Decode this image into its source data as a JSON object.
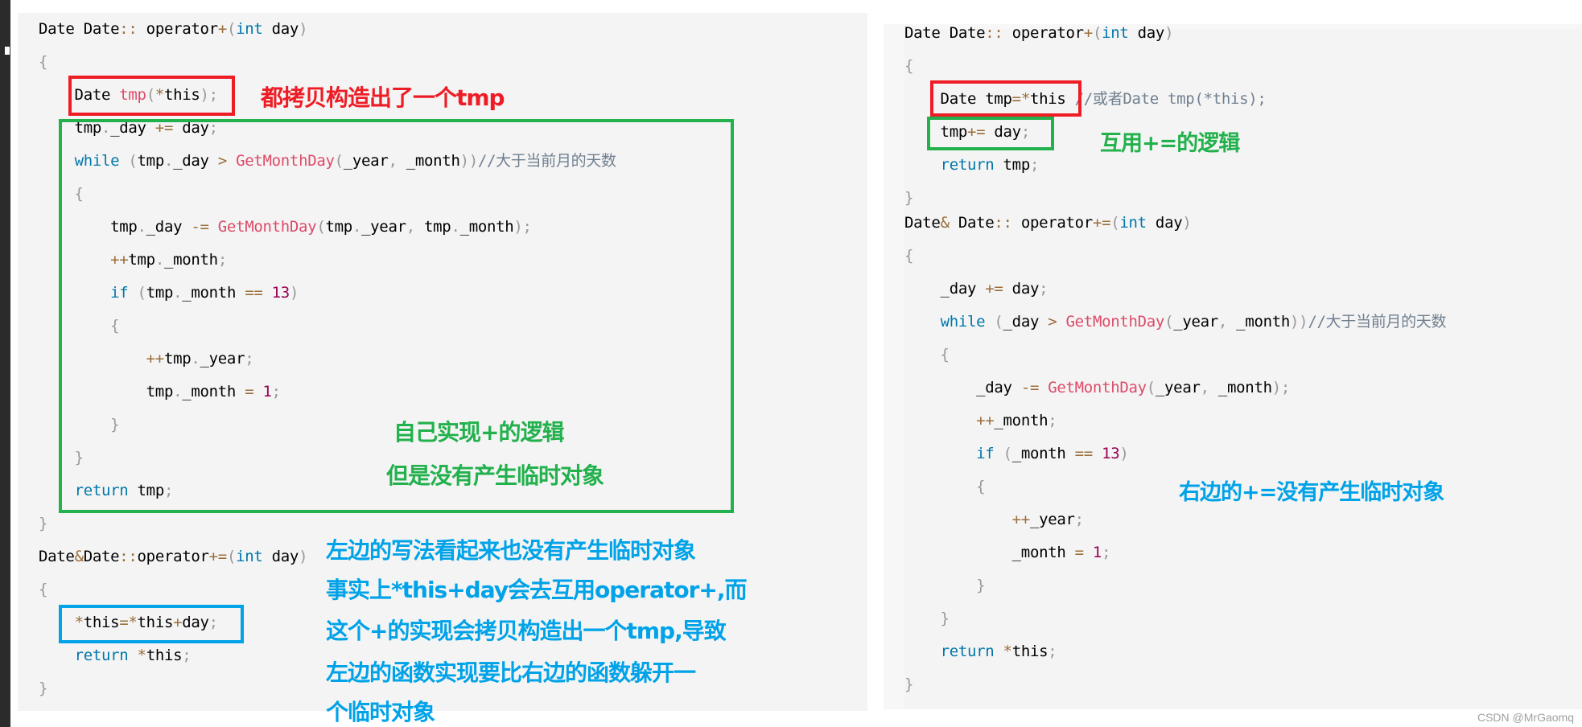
{
  "colors": {
    "red": "#ee1c25",
    "green": "#22b14c",
    "blue": "#00a2e8",
    "panel_bg": "#f4f4f4"
  },
  "left_code": [
    [
      [
        "Date Date",
        "t-plain"
      ],
      [
        "::",
        "t-op"
      ],
      [
        " operator",
        "t-plain"
      ],
      [
        "+",
        "t-op"
      ],
      [
        "(",
        "t-punc"
      ],
      [
        "int",
        "t-kw"
      ],
      [
        " day",
        "t-plain"
      ],
      [
        ")",
        "t-punc"
      ]
    ],
    [
      [
        "{",
        "t-punc"
      ]
    ],
    [
      [
        "    Date ",
        "t-plain"
      ],
      [
        "tmp",
        "t-fn"
      ],
      [
        "(",
        "t-punc"
      ],
      [
        "*",
        "t-op"
      ],
      [
        "this",
        "t-plain"
      ],
      [
        ")",
        "t-punc"
      ],
      [
        ";",
        "t-punc"
      ]
    ],
    [
      [
        "    tmp",
        "t-plain"
      ],
      [
        ".",
        "t-punc"
      ],
      [
        "_day ",
        "t-plain"
      ],
      [
        "+=",
        "t-op"
      ],
      [
        " day",
        "t-plain"
      ],
      [
        ";",
        "t-punc"
      ]
    ],
    [
      [
        "    ",
        "t-plain"
      ],
      [
        "while",
        "t-kw"
      ],
      [
        " ",
        "t-plain"
      ],
      [
        "(",
        "t-punc"
      ],
      [
        "tmp",
        "t-plain"
      ],
      [
        ".",
        "t-punc"
      ],
      [
        "_day ",
        "t-plain"
      ],
      [
        ">",
        "t-op"
      ],
      [
        " ",
        "t-plain"
      ],
      [
        "GetMonthDay",
        "t-fn"
      ],
      [
        "(",
        "t-punc"
      ],
      [
        "_year",
        "t-plain"
      ],
      [
        ",",
        "t-punc"
      ],
      [
        " _month",
        "t-plain"
      ],
      [
        "))",
        "t-punc"
      ],
      [
        "//大于当前月的天数",
        "t-comment"
      ]
    ],
    [
      [
        "    {",
        "t-punc"
      ]
    ],
    [
      [
        "        tmp",
        "t-plain"
      ],
      [
        ".",
        "t-punc"
      ],
      [
        "_day ",
        "t-plain"
      ],
      [
        "-=",
        "t-op"
      ],
      [
        " ",
        "t-plain"
      ],
      [
        "GetMonthDay",
        "t-fn"
      ],
      [
        "(",
        "t-punc"
      ],
      [
        "tmp",
        "t-plain"
      ],
      [
        ".",
        "t-punc"
      ],
      [
        "_year",
        "t-plain"
      ],
      [
        ",",
        "t-punc"
      ],
      [
        " tmp",
        "t-plain"
      ],
      [
        ".",
        "t-punc"
      ],
      [
        "_month",
        "t-plain"
      ],
      [
        ");",
        "t-punc"
      ]
    ],
    [
      [
        "        ",
        "t-plain"
      ],
      [
        "++",
        "t-op"
      ],
      [
        "tmp",
        "t-plain"
      ],
      [
        ".",
        "t-punc"
      ],
      [
        "_month",
        "t-plain"
      ],
      [
        ";",
        "t-punc"
      ]
    ],
    [
      [
        "        ",
        "t-plain"
      ],
      [
        "if",
        "t-kw"
      ],
      [
        " ",
        "t-plain"
      ],
      [
        "(",
        "t-punc"
      ],
      [
        "tmp",
        "t-plain"
      ],
      [
        ".",
        "t-punc"
      ],
      [
        "_month ",
        "t-plain"
      ],
      [
        "==",
        "t-op"
      ],
      [
        " ",
        "t-plain"
      ],
      [
        "13",
        "t-num"
      ],
      [
        ")",
        "t-punc"
      ]
    ],
    [
      [
        "        {",
        "t-punc"
      ]
    ],
    [
      [
        "            ",
        "t-plain"
      ],
      [
        "++",
        "t-op"
      ],
      [
        "tmp",
        "t-plain"
      ],
      [
        ".",
        "t-punc"
      ],
      [
        "_year",
        "t-plain"
      ],
      [
        ";",
        "t-punc"
      ]
    ],
    [
      [
        "            tmp",
        "t-plain"
      ],
      [
        ".",
        "t-punc"
      ],
      [
        "_month ",
        "t-plain"
      ],
      [
        "=",
        "t-op"
      ],
      [
        " ",
        "t-plain"
      ],
      [
        "1",
        "t-num"
      ],
      [
        ";",
        "t-punc"
      ]
    ],
    [
      [
        "        }",
        "t-punc"
      ]
    ],
    [
      [
        "    }",
        "t-punc"
      ]
    ],
    [
      [
        "    ",
        "t-plain"
      ],
      [
        "return",
        "t-kw"
      ],
      [
        " tmp",
        "t-plain"
      ],
      [
        ";",
        "t-punc"
      ]
    ],
    [
      [
        "}",
        "t-punc"
      ]
    ],
    [
      [
        "Date",
        "t-plain"
      ],
      [
        "&",
        "t-op"
      ],
      [
        "Date",
        "t-plain"
      ],
      [
        "::",
        "t-op"
      ],
      [
        "operator",
        "t-plain"
      ],
      [
        "+=",
        "t-op"
      ],
      [
        "(",
        "t-punc"
      ],
      [
        "int",
        "t-kw"
      ],
      [
        " day",
        "t-plain"
      ],
      [
        ")",
        "t-punc"
      ]
    ],
    [
      [
        "{",
        "t-punc"
      ]
    ],
    [
      [
        "    ",
        "t-plain"
      ],
      [
        "*",
        "t-op"
      ],
      [
        "this",
        "t-plain"
      ],
      [
        "=",
        "t-op"
      ],
      [
        "*",
        "t-op"
      ],
      [
        "this",
        "t-plain"
      ],
      [
        "+",
        "t-op"
      ],
      [
        "day",
        "t-plain"
      ],
      [
        ";",
        "t-punc"
      ]
    ],
    [
      [
        "    ",
        "t-plain"
      ],
      [
        "return",
        "t-kw"
      ],
      [
        " ",
        "t-plain"
      ],
      [
        "*",
        "t-op"
      ],
      [
        "this",
        "t-plain"
      ],
      [
        ";",
        "t-punc"
      ]
    ],
    [
      [
        "}",
        "t-punc"
      ]
    ]
  ],
  "right_code": [
    [
      [
        "Date Date",
        "t-plain"
      ],
      [
        "::",
        "t-op"
      ],
      [
        " operator",
        "t-plain"
      ],
      [
        "+",
        "t-op"
      ],
      [
        "(",
        "t-punc"
      ],
      [
        "int",
        "t-kw"
      ],
      [
        " day",
        "t-plain"
      ],
      [
        ")",
        "t-punc"
      ]
    ],
    [
      [
        "{",
        "t-punc"
      ]
    ],
    [
      [
        "    Date tmp",
        "t-plain"
      ],
      [
        "=",
        "t-op"
      ],
      [
        "*",
        "t-op"
      ],
      [
        "this",
        "t-plain"
      ],
      [
        " //或者Date tmp(*this);",
        "t-comment"
      ]
    ],
    [
      [
        "    tmp",
        "t-plain"
      ],
      [
        "+=",
        "t-op"
      ],
      [
        " day",
        "t-plain"
      ],
      [
        ";",
        "t-punc"
      ]
    ],
    [
      [
        "    ",
        "t-plain"
      ],
      [
        "return",
        "t-kw"
      ],
      [
        " tmp",
        "t-plain"
      ],
      [
        ";",
        "t-punc"
      ]
    ],
    [
      [
        "}",
        "t-punc"
      ]
    ],
    [
      [
        "Date",
        "t-plain"
      ],
      [
        "&",
        "t-op"
      ],
      [
        " Date",
        "t-plain"
      ],
      [
        "::",
        "t-op"
      ],
      [
        " operator",
        "t-plain"
      ],
      [
        "+=",
        "t-op"
      ],
      [
        "(",
        "t-punc"
      ],
      [
        "int",
        "t-kw"
      ],
      [
        " day",
        "t-plain"
      ],
      [
        ")",
        "t-punc"
      ]
    ],
    [
      [
        "{",
        "t-punc"
      ]
    ],
    [
      [
        "    _day ",
        "t-plain"
      ],
      [
        "+=",
        "t-op"
      ],
      [
        " day",
        "t-plain"
      ],
      [
        ";",
        "t-punc"
      ]
    ],
    [
      [
        "    ",
        "t-plain"
      ],
      [
        "while",
        "t-kw"
      ],
      [
        " ",
        "t-plain"
      ],
      [
        "(",
        "t-punc"
      ],
      [
        "_day ",
        "t-plain"
      ],
      [
        ">",
        "t-op"
      ],
      [
        " ",
        "t-plain"
      ],
      [
        "GetMonthDay",
        "t-fn"
      ],
      [
        "(",
        "t-punc"
      ],
      [
        "_year",
        "t-plain"
      ],
      [
        ",",
        "t-punc"
      ],
      [
        " _month",
        "t-plain"
      ],
      [
        "))",
        "t-punc"
      ],
      [
        "//大于当前月的天数",
        "t-comment"
      ]
    ],
    [
      [
        "    {",
        "t-punc"
      ]
    ],
    [
      [
        "        _day ",
        "t-plain"
      ],
      [
        "-=",
        "t-op"
      ],
      [
        " ",
        "t-plain"
      ],
      [
        "GetMonthDay",
        "t-fn"
      ],
      [
        "(",
        "t-punc"
      ],
      [
        "_year",
        "t-plain"
      ],
      [
        ",",
        "t-punc"
      ],
      [
        " _month",
        "t-plain"
      ],
      [
        ");",
        "t-punc"
      ]
    ],
    [
      [
        "        ",
        "t-plain"
      ],
      [
        "++",
        "t-op"
      ],
      [
        "_month",
        "t-plain"
      ],
      [
        ";",
        "t-punc"
      ]
    ],
    [
      [
        "        ",
        "t-plain"
      ],
      [
        "if",
        "t-kw"
      ],
      [
        " ",
        "t-plain"
      ],
      [
        "(",
        "t-punc"
      ],
      [
        "_month ",
        "t-plain"
      ],
      [
        "==",
        "t-op"
      ],
      [
        " ",
        "t-plain"
      ],
      [
        "13",
        "t-num"
      ],
      [
        ")",
        "t-punc"
      ]
    ],
    [
      [
        "        {",
        "t-punc"
      ]
    ],
    [
      [
        "            ",
        "t-plain"
      ],
      [
        "++",
        "t-op"
      ],
      [
        "_year",
        "t-plain"
      ],
      [
        ";",
        "t-punc"
      ]
    ],
    [
      [
        "            _month ",
        "t-plain"
      ],
      [
        "=",
        "t-op"
      ],
      [
        " ",
        "t-plain"
      ],
      [
        "1",
        "t-num"
      ],
      [
        ";",
        "t-punc"
      ]
    ],
    [
      [
        "        }",
        "t-punc"
      ]
    ],
    [
      [
        "    }",
        "t-punc"
      ]
    ],
    [
      [
        "    ",
        "t-plain"
      ],
      [
        "return",
        "t-kw"
      ],
      [
        " ",
        "t-plain"
      ],
      [
        "*",
        "t-op"
      ],
      [
        "this",
        "t-plain"
      ],
      [
        ";",
        "t-punc"
      ]
    ],
    [
      [
        "}",
        "t-punc"
      ]
    ]
  ],
  "annotations": {
    "left_red": "都拷贝构造出了一个tmp",
    "left_green_1": "自己实现+的逻辑",
    "left_green_2": "但是没有产生临时对象",
    "left_blue": [
      "左边的写法看起来也没有产生临时对象",
      "事实上*this+day会去互用operator+,而",
      "这个+的实现会拷贝构造出一个tmp,导致",
      "左边的函数实现要比右边的函数躲开一",
      "个临时对象"
    ],
    "right_green": "互用+=的逻辑",
    "right_blue": "右边的+=没有产生临时对象"
  },
  "watermark": "CSDN @MrGaomq"
}
